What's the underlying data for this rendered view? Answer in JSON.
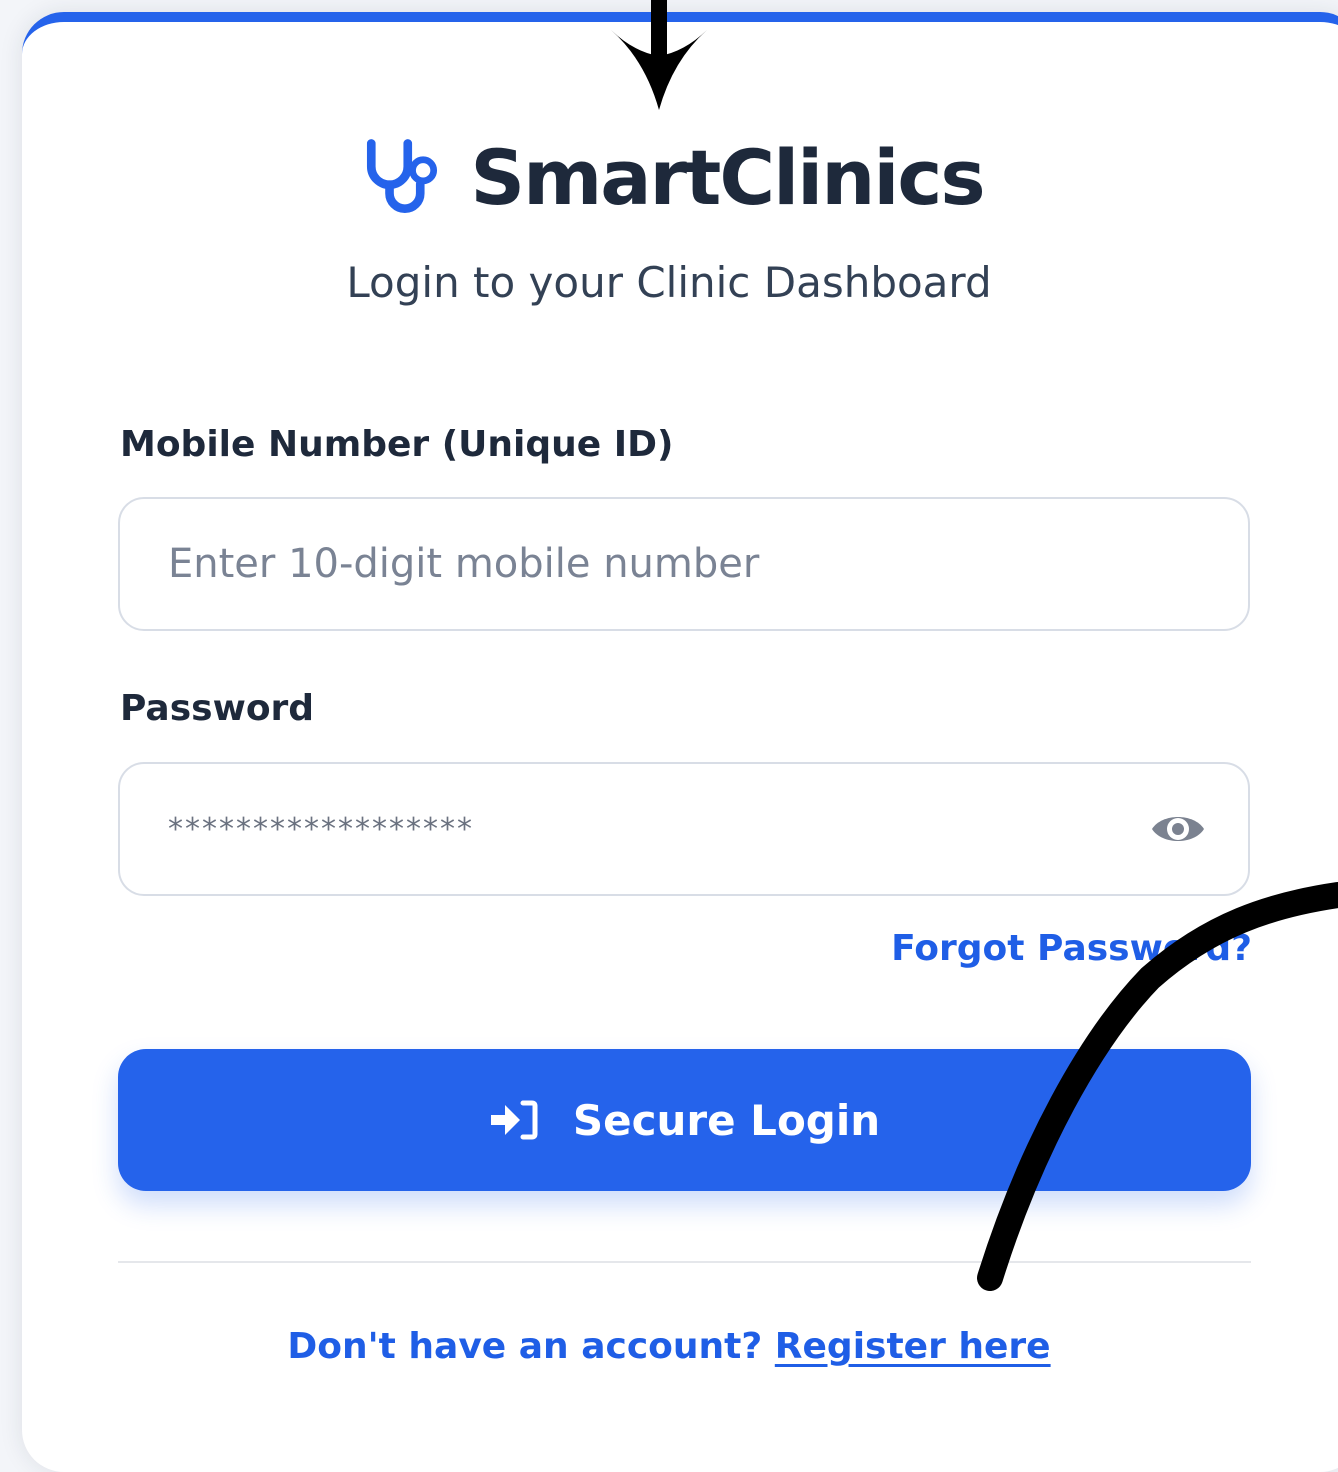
{
  "brand": {
    "name": "SmartClinics",
    "subtitle": "Login to your Clinic Dashboard"
  },
  "form": {
    "mobile": {
      "label": "Mobile Number (Unique ID)",
      "placeholder": "Enter 10-digit mobile number",
      "value": ""
    },
    "password": {
      "label": "Password",
      "value": "******************"
    },
    "forgot_password": "Forgot Password?",
    "submit_label": "Secure Login"
  },
  "footer": {
    "prompt": "Don't have an account?",
    "register_link": "Register here"
  },
  "icons": {
    "brand": "stethoscope-icon",
    "password_toggle": "eye-icon",
    "submit": "login-arrow-icon"
  },
  "colors": {
    "accent": "#2563eb",
    "link": "#1f5ee6",
    "heading": "#1e293b",
    "muted": "#7a8394",
    "border": "#d8dde6",
    "annotation": "#000000"
  }
}
